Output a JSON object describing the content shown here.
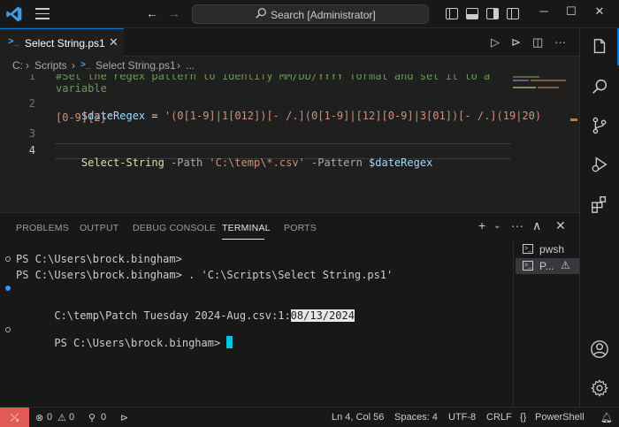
{
  "titlebar": {
    "search_text": "Search [Administrator]"
  },
  "editor_tab": {
    "label": "Select String.ps1"
  },
  "breadcrumb": {
    "drive": "C:",
    "folder": "Scripts",
    "file": "Select String.ps1",
    "more": "..."
  },
  "editor": {
    "line_numbers": [
      "1",
      "2",
      "3",
      "4"
    ],
    "line1_comment": "#Set the regex pattern to identify MM/DD/YYYY format and set it to a",
    "line1_cont": "variable",
    "line2_var": "$dateRegex",
    "line2_eq": " = ",
    "line2_str": "'(0[1-9]|1[012])[- /.](0[1-9]|[12][0-9]|3[01])[- /.](19|20)",
    "line2_cont": "[0-9]{2}'",
    "line4_cmd": "Select-String",
    "line4_p1": " -Path ",
    "line4_path": "'C:\\temp\\*.csv'",
    "line4_p2": " -Pattern ",
    "line4_var": "$dateRegex"
  },
  "panel": {
    "tabs": [
      "PROBLEMS",
      "OUTPUT",
      "DEBUG CONSOLE",
      "TERMINAL",
      "PORTS"
    ],
    "active_tab": "TERMINAL"
  },
  "terminal": {
    "line1": "PS C:\\Users\\brock.bingham>",
    "line2": "PS C:\\Users\\brock.bingham> . 'C:\\Scripts\\Select String.ps1'",
    "line3_prefix": "C:\\temp\\Patch Tuesday 2024-Aug.csv:1:",
    "line3_match": "08/13/2024",
    "line4": "PS C:\\Users\\brock.bingham> "
  },
  "terminal_list": {
    "items": [
      {
        "label": "pwsh"
      },
      {
        "label": "P..."
      }
    ]
  },
  "statusbar": {
    "errors": "0",
    "warnings": "0",
    "ports": "0",
    "position": "Ln 4, Col 56",
    "spaces": "Spaces: 4",
    "encoding": "UTF-8",
    "eol": "CRLF",
    "language": "PowerShell",
    "language_prefix": "{}"
  },
  "colors": {
    "accent": "#0078d4",
    "remote": "#e25a55",
    "terminal_cursor": "#00c4e6"
  }
}
